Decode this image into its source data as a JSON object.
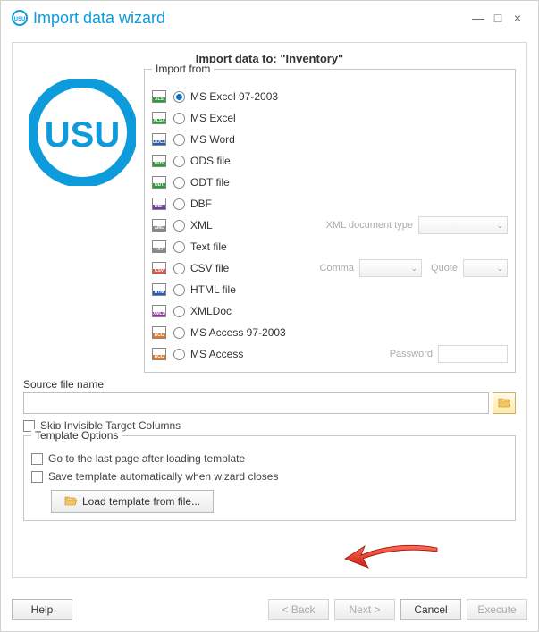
{
  "window": {
    "title": "Import data wizard"
  },
  "panel": {
    "title": "Import data to: \"Inventory\""
  },
  "importFrom": {
    "legend": "Import from",
    "items": [
      {
        "label": "MS Excel 97-2003",
        "badge": "XLS",
        "color": "#2e9b3a",
        "selected": true
      },
      {
        "label": "MS Excel",
        "badge": "XLSX",
        "color": "#2e9b3a"
      },
      {
        "label": "MS Word",
        "badge": "DOCX",
        "color": "#2a5db0"
      },
      {
        "label": "ODS file",
        "badge": "ODS",
        "color": "#2e9b3a"
      },
      {
        "label": "ODT file",
        "badge": "ODT",
        "color": "#2e9b3a"
      },
      {
        "label": "DBF",
        "badge": "DBF",
        "color": "#6a3fa0"
      },
      {
        "label": "XML",
        "badge": "XML",
        "color": "#888",
        "aux": "xmltype"
      },
      {
        "label": "Text file",
        "badge": "TXT",
        "color": "#888"
      },
      {
        "label": "CSV file",
        "badge": "CSV",
        "color": "#d9534f",
        "aux": "csv"
      },
      {
        "label": "HTML file",
        "badge": "HTM",
        "color": "#2a5db0"
      },
      {
        "label": "XMLDoc",
        "badge": "XMLD",
        "color": "#8e2fa0"
      },
      {
        "label": "MS Access 97-2003",
        "badge": "ACC",
        "color": "#d97a2f"
      },
      {
        "label": "MS Access",
        "badge": "ACC",
        "color": "#d97a2f",
        "aux": "password"
      }
    ],
    "aux": {
      "xmlTypeLabel": "XML document type",
      "commaLabel": "Comma",
      "quoteLabel": "Quote",
      "passwordLabel": "Password"
    }
  },
  "source": {
    "label": "Source file name",
    "value": ""
  },
  "skipInvisible": "Skip Invisible Target Columns",
  "template": {
    "legend": "Template Options",
    "goLast": "Go to the last page after loading template",
    "autoSave": "Save template automatically when wizard closes",
    "loadBtn": "Load template from file..."
  },
  "footer": {
    "help": "Help",
    "back": "< Back",
    "next": "Next >",
    "cancel": "Cancel",
    "execute": "Execute"
  }
}
